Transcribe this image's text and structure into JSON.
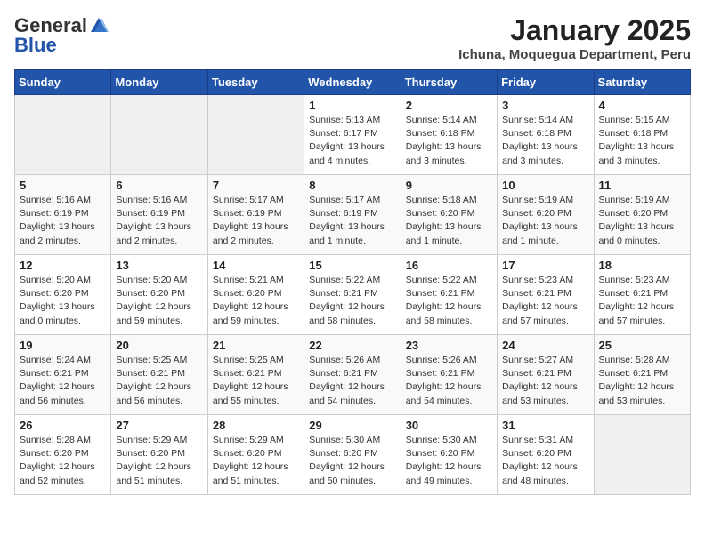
{
  "logo": {
    "general": "General",
    "blue": "Blue"
  },
  "header": {
    "month": "January 2025",
    "location": "Ichuna, Moquegua Department, Peru"
  },
  "weekdays": [
    "Sunday",
    "Monday",
    "Tuesday",
    "Wednesday",
    "Thursday",
    "Friday",
    "Saturday"
  ],
  "weeks": [
    [
      {
        "day": "",
        "info": ""
      },
      {
        "day": "",
        "info": ""
      },
      {
        "day": "",
        "info": ""
      },
      {
        "day": "1",
        "info": "Sunrise: 5:13 AM\nSunset: 6:17 PM\nDaylight: 13 hours\nand 4 minutes."
      },
      {
        "day": "2",
        "info": "Sunrise: 5:14 AM\nSunset: 6:18 PM\nDaylight: 13 hours\nand 3 minutes."
      },
      {
        "day": "3",
        "info": "Sunrise: 5:14 AM\nSunset: 6:18 PM\nDaylight: 13 hours\nand 3 minutes."
      },
      {
        "day": "4",
        "info": "Sunrise: 5:15 AM\nSunset: 6:18 PM\nDaylight: 13 hours\nand 3 minutes."
      }
    ],
    [
      {
        "day": "5",
        "info": "Sunrise: 5:16 AM\nSunset: 6:19 PM\nDaylight: 13 hours\nand 2 minutes."
      },
      {
        "day": "6",
        "info": "Sunrise: 5:16 AM\nSunset: 6:19 PM\nDaylight: 13 hours\nand 2 minutes."
      },
      {
        "day": "7",
        "info": "Sunrise: 5:17 AM\nSunset: 6:19 PM\nDaylight: 13 hours\nand 2 minutes."
      },
      {
        "day": "8",
        "info": "Sunrise: 5:17 AM\nSunset: 6:19 PM\nDaylight: 13 hours\nand 1 minute."
      },
      {
        "day": "9",
        "info": "Sunrise: 5:18 AM\nSunset: 6:20 PM\nDaylight: 13 hours\nand 1 minute."
      },
      {
        "day": "10",
        "info": "Sunrise: 5:19 AM\nSunset: 6:20 PM\nDaylight: 13 hours\nand 1 minute."
      },
      {
        "day": "11",
        "info": "Sunrise: 5:19 AM\nSunset: 6:20 PM\nDaylight: 13 hours\nand 0 minutes."
      }
    ],
    [
      {
        "day": "12",
        "info": "Sunrise: 5:20 AM\nSunset: 6:20 PM\nDaylight: 13 hours\nand 0 minutes."
      },
      {
        "day": "13",
        "info": "Sunrise: 5:20 AM\nSunset: 6:20 PM\nDaylight: 12 hours\nand 59 minutes."
      },
      {
        "day": "14",
        "info": "Sunrise: 5:21 AM\nSunset: 6:20 PM\nDaylight: 12 hours\nand 59 minutes."
      },
      {
        "day": "15",
        "info": "Sunrise: 5:22 AM\nSunset: 6:21 PM\nDaylight: 12 hours\nand 58 minutes."
      },
      {
        "day": "16",
        "info": "Sunrise: 5:22 AM\nSunset: 6:21 PM\nDaylight: 12 hours\nand 58 minutes."
      },
      {
        "day": "17",
        "info": "Sunrise: 5:23 AM\nSunset: 6:21 PM\nDaylight: 12 hours\nand 57 minutes."
      },
      {
        "day": "18",
        "info": "Sunrise: 5:23 AM\nSunset: 6:21 PM\nDaylight: 12 hours\nand 57 minutes."
      }
    ],
    [
      {
        "day": "19",
        "info": "Sunrise: 5:24 AM\nSunset: 6:21 PM\nDaylight: 12 hours\nand 56 minutes."
      },
      {
        "day": "20",
        "info": "Sunrise: 5:25 AM\nSunset: 6:21 PM\nDaylight: 12 hours\nand 56 minutes."
      },
      {
        "day": "21",
        "info": "Sunrise: 5:25 AM\nSunset: 6:21 PM\nDaylight: 12 hours\nand 55 minutes."
      },
      {
        "day": "22",
        "info": "Sunrise: 5:26 AM\nSunset: 6:21 PM\nDaylight: 12 hours\nand 54 minutes."
      },
      {
        "day": "23",
        "info": "Sunrise: 5:26 AM\nSunset: 6:21 PM\nDaylight: 12 hours\nand 54 minutes."
      },
      {
        "day": "24",
        "info": "Sunrise: 5:27 AM\nSunset: 6:21 PM\nDaylight: 12 hours\nand 53 minutes."
      },
      {
        "day": "25",
        "info": "Sunrise: 5:28 AM\nSunset: 6:21 PM\nDaylight: 12 hours\nand 53 minutes."
      }
    ],
    [
      {
        "day": "26",
        "info": "Sunrise: 5:28 AM\nSunset: 6:20 PM\nDaylight: 12 hours\nand 52 minutes."
      },
      {
        "day": "27",
        "info": "Sunrise: 5:29 AM\nSunset: 6:20 PM\nDaylight: 12 hours\nand 51 minutes."
      },
      {
        "day": "28",
        "info": "Sunrise: 5:29 AM\nSunset: 6:20 PM\nDaylight: 12 hours\nand 51 minutes."
      },
      {
        "day": "29",
        "info": "Sunrise: 5:30 AM\nSunset: 6:20 PM\nDaylight: 12 hours\nand 50 minutes."
      },
      {
        "day": "30",
        "info": "Sunrise: 5:30 AM\nSunset: 6:20 PM\nDaylight: 12 hours\nand 49 minutes."
      },
      {
        "day": "31",
        "info": "Sunrise: 5:31 AM\nSunset: 6:20 PM\nDaylight: 12 hours\nand 48 minutes."
      },
      {
        "day": "",
        "info": ""
      }
    ]
  ]
}
